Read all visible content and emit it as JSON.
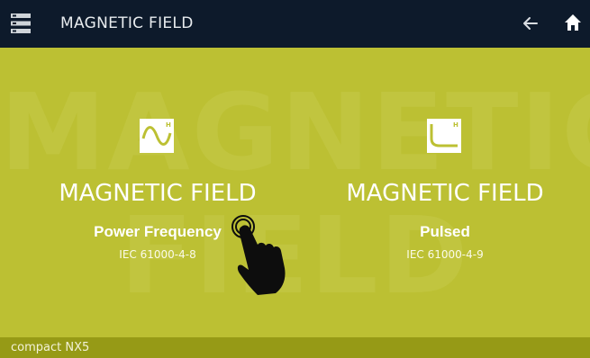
{
  "header": {
    "title": "MAGNETIC FIELD",
    "menu_icon": "menu-icon",
    "back_icon": "arrow-left-icon",
    "home_icon": "home-icon"
  },
  "watermark": {
    "line1": "MAGNETIC",
    "line2": "FIELD"
  },
  "options": [
    {
      "title": "MAGNETIC FIELD",
      "subtitle": "Power Frequency",
      "standard": "IEC 61000-4-8",
      "icon": "sine-wave-h-icon"
    },
    {
      "title": "MAGNETIC FIELD",
      "subtitle": "Pulsed",
      "standard": "IEC 61000-4-9",
      "icon": "pulse-wave-h-icon"
    }
  ],
  "footer": {
    "device": "compact NX5"
  },
  "colors": {
    "background": "#bcc033",
    "header": "#0d1a2b",
    "footer": "#969a16"
  }
}
